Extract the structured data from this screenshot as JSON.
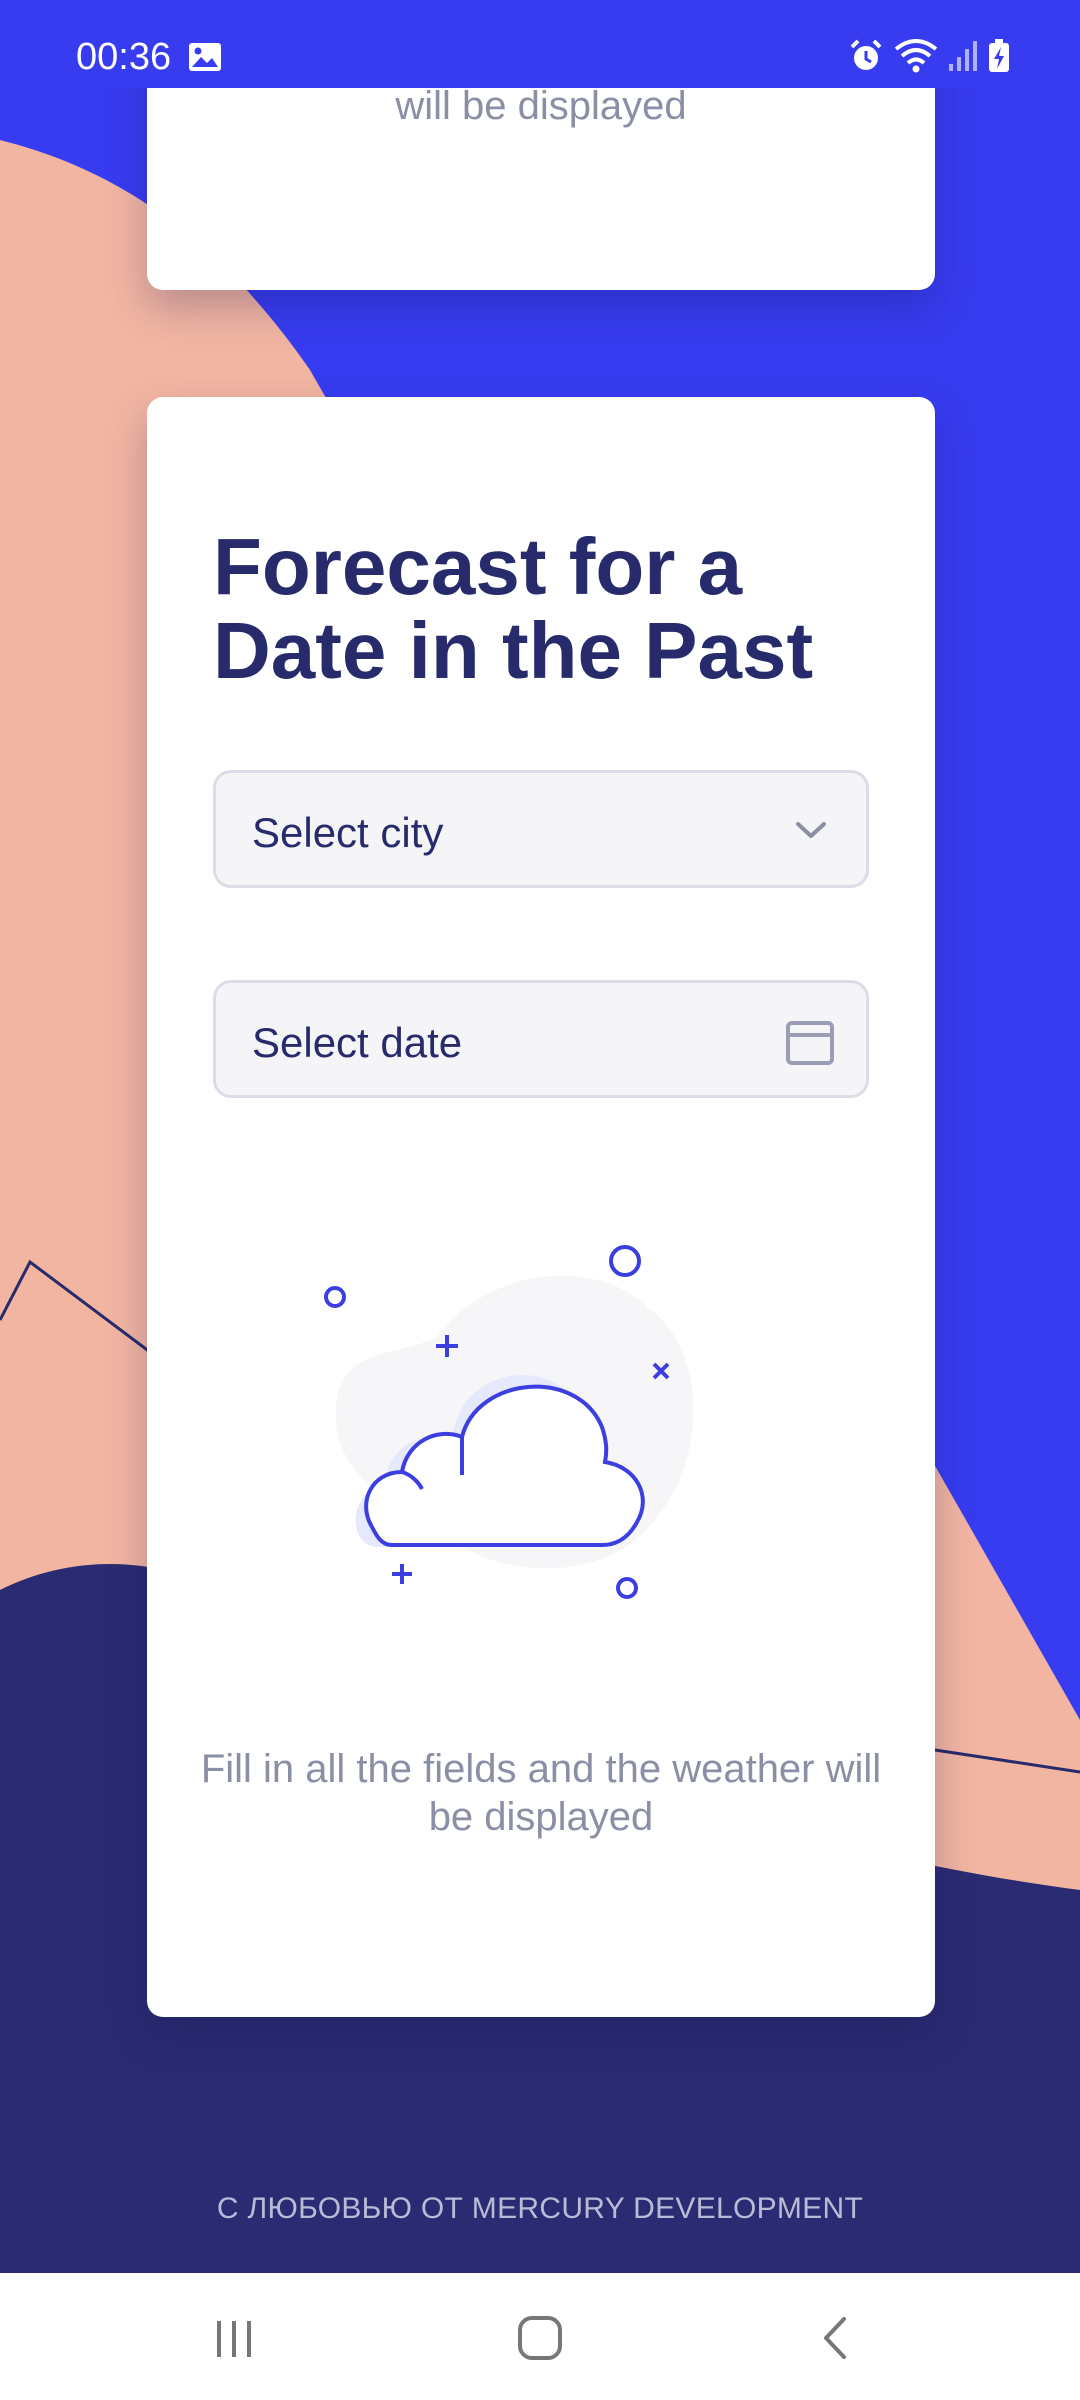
{
  "status_bar": {
    "time": "00:36",
    "icons": [
      "gallery-icon",
      "alarm-icon",
      "wifi-icon",
      "signal-icon",
      "battery-charging-icon"
    ]
  },
  "top_card": {
    "message": "will be displayed"
  },
  "forecast_card": {
    "title": "Forecast for a Date in the Past",
    "city_select": {
      "placeholder": "Select city",
      "icon": "chevron-down-icon"
    },
    "date_select": {
      "placeholder": "Select date",
      "icon": "calendar-icon"
    },
    "illustration": "cloud-icon",
    "hint": "Fill in all the fields and the weather will be displayed"
  },
  "footer": {
    "credit": "С ЛЮБОВЬЮ ОТ MERCURY DEVELOPMENT"
  },
  "nav_bar": {
    "buttons": [
      "recent-apps-icon",
      "home-icon",
      "back-icon"
    ]
  },
  "colors": {
    "accent_blue": "#373CF0",
    "navy": "#272B6B",
    "salmon": "#F2B5A2",
    "muted_text": "#8B8FA5"
  }
}
